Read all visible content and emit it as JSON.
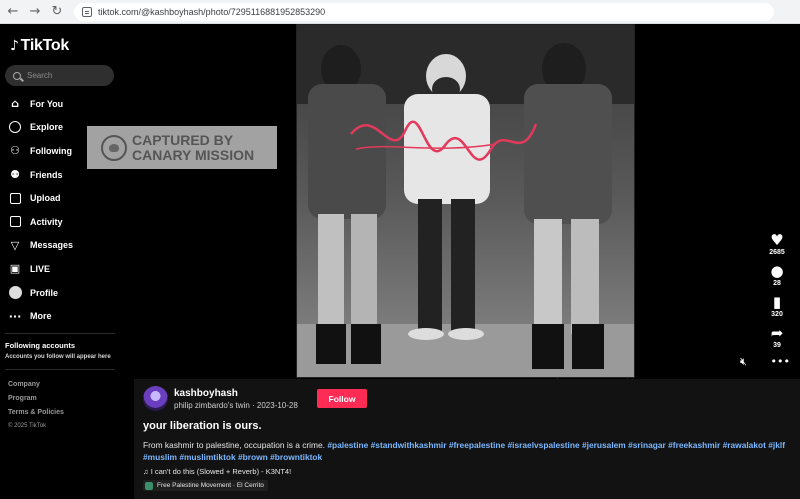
{
  "browser": {
    "back": "←",
    "forward": "→",
    "reload": "↻",
    "url": "tiktok.com/@kashboyhash/photo/7295116881952853290"
  },
  "brand": {
    "name": "TikTok"
  },
  "search": {
    "placeholder": "Search"
  },
  "nav": [
    {
      "label": "For You",
      "icon": "home-icon"
    },
    {
      "label": "Explore",
      "icon": "compass-icon"
    },
    {
      "label": "Following",
      "icon": "user-plus-icon"
    },
    {
      "label": "Friends",
      "icon": "friends-icon"
    },
    {
      "label": "Upload",
      "icon": "upload-icon"
    },
    {
      "label": "Activity",
      "icon": "activity-icon"
    },
    {
      "label": "Messages",
      "icon": "send-icon"
    },
    {
      "label": "LIVE",
      "icon": "live-icon"
    },
    {
      "label": "Profile",
      "icon": "profile-avatar-icon"
    },
    {
      "label": "More",
      "icon": "more-dots-icon"
    }
  ],
  "following": {
    "heading": "Following accounts",
    "subtext": "Accounts you follow will appear here"
  },
  "footer": {
    "company": "Company",
    "program": "Program",
    "terms": "Terms & Policies",
    "copyright": "© 2025 TikTok"
  },
  "watermark": {
    "line1": "CAPTURED BY",
    "line2": "CANARY MISSION"
  },
  "carousel": {
    "prev": "‹",
    "next": "›",
    "slide_count": 5,
    "active_index": 3
  },
  "rail": {
    "likes": "2685",
    "comments": "28",
    "saves": "320",
    "shares": "39"
  },
  "post": {
    "username": "kashboyhash",
    "nickname": "philip zimbardo's twin",
    "date": "2023-10-28",
    "separator": " · ",
    "follow_label": "Follow",
    "title": "your liberation is ours.",
    "caption_text": "From kashmir to palestine, occupation is a crime. ",
    "hashtags": [
      "#palestine",
      "#standwithkashmir",
      "#freepalestine",
      "#israelvspalestine",
      "#jerusalem",
      "#srinagar",
      "#freekashmir",
      "#rawalakot",
      "#jklf",
      "#muslim",
      "#muslimtiktok",
      "#brown",
      "#browntiktok"
    ],
    "music": "♫ I can't do this (Slowed + Reverb) - K3NT4!",
    "location": "Free Palestine Movement · El Cerrito"
  },
  "colors": {
    "follow_button": "#fe2c55",
    "hashtag": "#7bb7ff",
    "background": "#000000",
    "details_panel": "#121212"
  }
}
